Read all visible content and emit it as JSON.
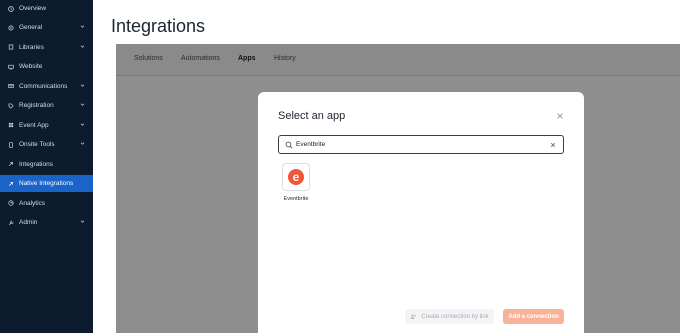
{
  "sidebar": {
    "items": [
      {
        "label": "Overview",
        "icon": "clock-icon"
      },
      {
        "label": "General",
        "icon": "gear-icon",
        "expandable": true
      },
      {
        "label": "Libraries",
        "icon": "book-icon",
        "expandable": true
      },
      {
        "label": "Website",
        "icon": "monitor-icon"
      },
      {
        "label": "Communications",
        "icon": "envelope-icon",
        "expandable": true
      },
      {
        "label": "Registration",
        "icon": "tag-icon",
        "expandable": true
      },
      {
        "label": "Event App",
        "icon": "grid-icon",
        "expandable": true
      },
      {
        "label": "Onsite Tools",
        "icon": "phone-icon",
        "expandable": true
      },
      {
        "label": "Integrations",
        "icon": "link-icon"
      },
      {
        "label": "Native Integrations",
        "icon": "link-icon",
        "active": true
      },
      {
        "label": "Analytics",
        "icon": "chart-icon"
      },
      {
        "label": "Admin",
        "icon": "wrench-icon",
        "expandable": true
      }
    ]
  },
  "page": {
    "title": "Integrations"
  },
  "tabs": [
    {
      "label": "Solutions"
    },
    {
      "label": "Automations"
    },
    {
      "label": "Apps",
      "active": true
    },
    {
      "label": "History"
    }
  ],
  "modal": {
    "title": "Select an app",
    "search_value": "Eventbrite",
    "apps": [
      {
        "name": "Eventbrite",
        "logo_letter": "e"
      }
    ],
    "create_link_label": "Create connection by link",
    "add_connection_label": "Add a connection"
  },
  "colors": {
    "sidebar_bg": "#0c1b2e",
    "active_item": "#1a63c9",
    "overlay": "#8e8e8e",
    "add_button": "#f7b39a",
    "eventbrite": "#f05537"
  }
}
